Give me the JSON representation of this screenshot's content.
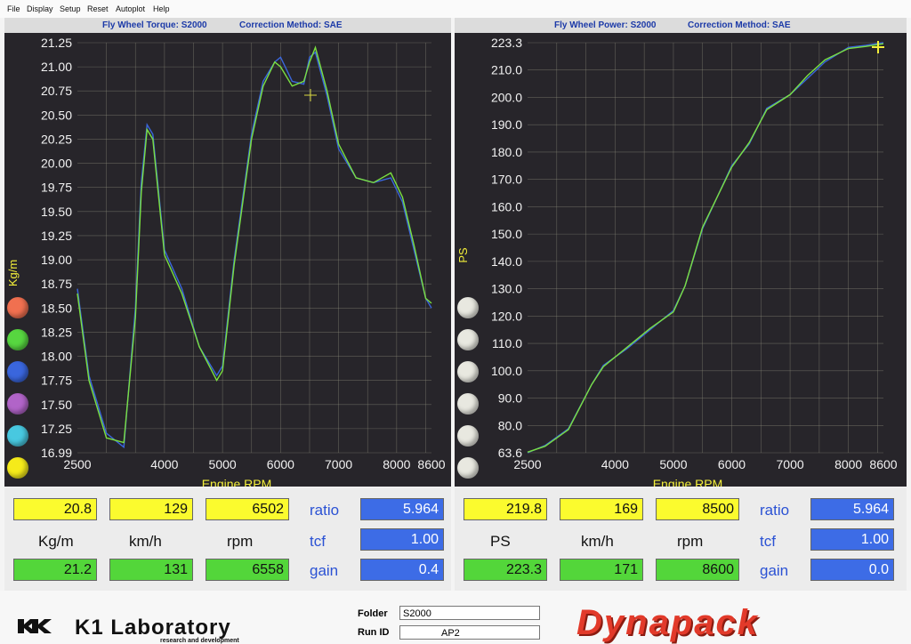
{
  "menu": [
    "File",
    "Display",
    "Setup",
    "Reset",
    "Autoplot",
    "Help"
  ],
  "torque": {
    "title": "Fly Wheel Torque: S2000",
    "correction": "Correction Method: SAE",
    "ylabel": "Kg/m",
    "xlabel": "Engine RPM",
    "yticks": [
      "21.25",
      "21.00",
      "20.75",
      "20.50",
      "20.25",
      "20.00",
      "19.75",
      "19.50",
      "19.25",
      "19.00",
      "18.75",
      "18.50",
      "18.25",
      "18.00",
      "17.75",
      "17.50",
      "17.25",
      "16.99"
    ],
    "xticks": [
      "2500",
      "4000",
      "5000",
      "6000",
      "7000",
      "8000",
      "8600"
    ]
  },
  "power": {
    "title": "Fly Wheel Power: S2000",
    "correction": "Correction Method: SAE",
    "ylabel": "PS",
    "xlabel": "Engine RPM",
    "yticks": [
      "223.3",
      "210.0",
      "200.0",
      "190.0",
      "180.0",
      "170.0",
      "160.0",
      "150.0",
      "140.0",
      "130.0",
      "120.0",
      "110.0",
      "100.0",
      "90.0",
      "80.0",
      "63.6"
    ],
    "xticks": [
      "2500",
      "4000",
      "5000",
      "6000",
      "7000",
      "8000",
      "8600"
    ]
  },
  "legend_colors": [
    "#f07050",
    "#57d640",
    "#3a66dd",
    "#b164c8",
    "#48c8e0",
    "#f5ea1a"
  ],
  "power_legend_colors": [
    "#e8e8e0",
    "#e8e8e0",
    "#e8e8e0",
    "#e8e8e0",
    "#e8e8e0",
    "#e8e8e0"
  ],
  "chart_data": [
    {
      "type": "line",
      "title": "Fly Wheel Torque: S2000",
      "xlabel": "Engine RPM",
      "ylabel": "Kg/m",
      "xlim": [
        2500,
        8600
      ],
      "ylim": [
        16.99,
        21.25
      ],
      "grid": true,
      "series": [
        {
          "color": "#3a66dd",
          "x": [
            2500,
            2700,
            3000,
            3300,
            3500,
            3600,
            3700,
            3800,
            4000,
            4300,
            4600,
            4900,
            5000,
            5200,
            5500,
            5700,
            5900,
            6000,
            6200,
            6400,
            6500,
            6600,
            6800,
            7000,
            7300,
            7600,
            7900,
            8100,
            8300,
            8500,
            8600
          ],
          "y": [
            18.7,
            17.8,
            17.2,
            17.05,
            18.5,
            19.8,
            20.4,
            20.3,
            19.1,
            18.7,
            18.1,
            17.8,
            17.9,
            19.0,
            20.3,
            20.85,
            21.05,
            21.1,
            20.85,
            20.82,
            21.1,
            21.15,
            20.7,
            20.15,
            19.85,
            19.8,
            19.85,
            19.6,
            19.1,
            18.6,
            18.5
          ]
        },
        {
          "color": "#7ae040",
          "x": [
            2500,
            2700,
            3000,
            3300,
            3500,
            3600,
            3700,
            3800,
            4000,
            4300,
            4600,
            4900,
            5000,
            5200,
            5500,
            5700,
            5900,
            6000,
            6200,
            6400,
            6500,
            6600,
            6800,
            7000,
            7300,
            7600,
            7900,
            8100,
            8300,
            8500,
            8600
          ],
          "y": [
            18.65,
            17.75,
            17.15,
            17.1,
            18.4,
            19.7,
            20.35,
            20.25,
            19.05,
            18.65,
            18.1,
            17.75,
            17.85,
            18.95,
            20.25,
            20.8,
            21.05,
            21.0,
            20.8,
            20.85,
            21.05,
            21.2,
            20.75,
            20.2,
            19.85,
            19.8,
            19.9,
            19.65,
            19.15,
            18.6,
            18.55
          ]
        }
      ]
    },
    {
      "type": "line",
      "title": "Fly Wheel Power: S2000",
      "xlabel": "Engine RPM",
      "ylabel": "PS",
      "xlim": [
        2500,
        8600
      ],
      "ylim": [
        63.6,
        223.3
      ],
      "grid": true,
      "series": [
        {
          "color": "#3a66dd",
          "x": [
            2500,
            2800,
            3200,
            3600,
            3800,
            4200,
            4600,
            5000,
            5200,
            5500,
            6000,
            6300,
            6600,
            7000,
            7300,
            7600,
            8000,
            8300,
            8600
          ],
          "y": [
            63.6,
            68,
            78,
            95,
            102,
            108,
            115,
            122,
            131,
            152,
            175,
            183,
            196,
            201,
            207,
            214,
            221,
            222,
            223.3
          ]
        },
        {
          "color": "#7ae040",
          "x": [
            2500,
            2800,
            3200,
            3600,
            3800,
            4200,
            4600,
            5000,
            5200,
            5500,
            6000,
            6300,
            6600,
            7000,
            7300,
            7600,
            8000,
            8300,
            8600
          ],
          "y": [
            64,
            67.5,
            77.5,
            95,
            101.5,
            108.5,
            115.5,
            121.5,
            131,
            152.5,
            174.5,
            183.5,
            195.5,
            201,
            208,
            215,
            220.5,
            221.5,
            222.8
          ]
        }
      ]
    }
  ],
  "torque_readout": {
    "cur_value": "20.8",
    "cur_speed": "129",
    "cur_rpm": "6502",
    "unit_value": "Kg/m",
    "unit_speed": "km/h",
    "unit_rpm": "rpm",
    "max_value": "21.2",
    "max_speed": "131",
    "max_rpm": "6558",
    "ratio_label": "ratio",
    "ratio": "5.964",
    "tcf_label": "tcf",
    "tcf": "1.00",
    "gain_label": "gain",
    "gain": "0.4"
  },
  "power_readout": {
    "cur_value": "219.8",
    "cur_speed": "169",
    "cur_rpm": "8500",
    "unit_value": "PS",
    "unit_speed": "km/h",
    "unit_rpm": "rpm",
    "max_value": "223.3",
    "max_speed": "171",
    "max_rpm": "8600",
    "ratio_label": "ratio",
    "ratio": "5.964",
    "tcf_label": "tcf",
    "tcf": "1.00",
    "gain_label": "gain",
    "gain": "0.0"
  },
  "footer": {
    "k1_logo": "K1 Laboratory",
    "k1_subtitle": "research and development",
    "folder_label": "Folder",
    "folder_value": "S2000",
    "runid_label": "Run ID",
    "runid_value": "AP2",
    "brand": "Dynapack"
  }
}
